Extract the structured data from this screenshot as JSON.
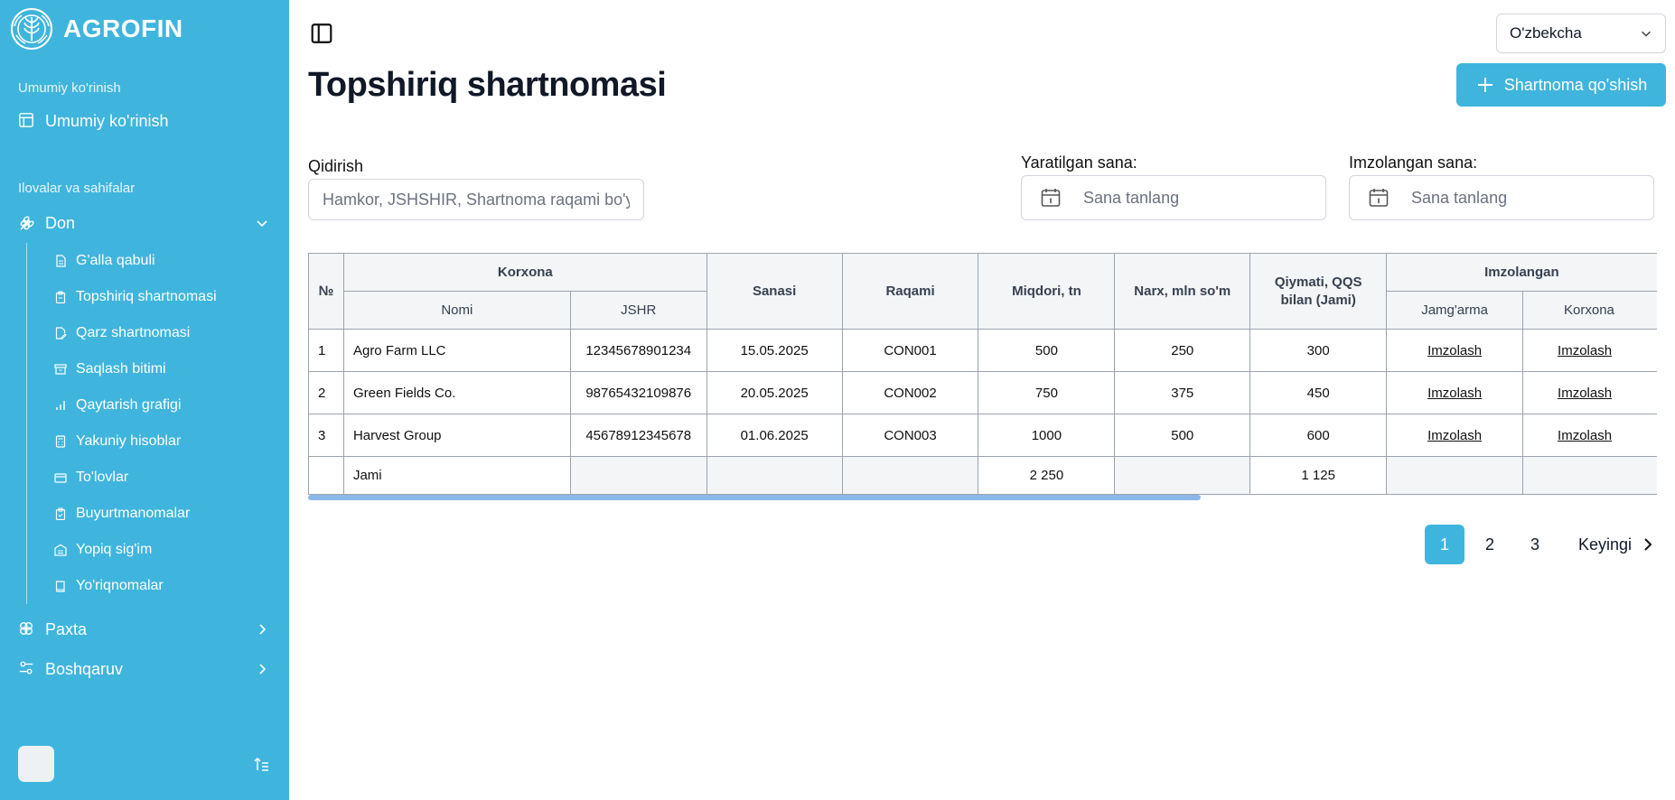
{
  "brand": {
    "name": "AGROFIN"
  },
  "sidebar": {
    "group1_label": "Umumiy ko'rinish",
    "overview": "Umumiy ko'rinish",
    "group2_label": "Ilovalar va sahifalar",
    "don": "Don",
    "sub_items": [
      "G'alla qabuli",
      "Topshiriq shartnomasi",
      "Qarz shartnomasi",
      "Saqlash bitimi",
      "Qaytarish grafigi",
      "Yakuniy hisoblar",
      "To'lovlar",
      "Buyurtmanomalar",
      "Yopiq sig'im",
      "Yo'riqnomalar"
    ],
    "paxta": "Paxta",
    "boshqaruv": "Boshqaruv"
  },
  "header": {
    "language": "O'zbekcha",
    "title": "Topshiriq shartnomasi",
    "add_button": "Shartnoma qo'shish"
  },
  "filters": {
    "search_label": "Qidirish",
    "search_placeholder": "Hamkor, JSHSHIR, Shartnoma raqami bo'yicha",
    "created_label": "Yaratilgan sana:",
    "created_placeholder": "Sana tanlang",
    "signed_label": "Imzolangan sana:",
    "signed_placeholder": "Sana tanlang"
  },
  "table": {
    "headers": {
      "num": "№",
      "korxona": "Korxona",
      "nomi": "Nomi",
      "jshr": "JSHR",
      "sanasi": "Sanasi",
      "raqami": "Raqami",
      "miqdori": "Miqdori, tn",
      "narx": "Narx, mln so'm",
      "qiymati": "Qiymati, QQS bilan (Jami)",
      "imzolangan": "Imzolangan",
      "jamgarma": "Jamg'arma",
      "korxona2": "Korxona"
    },
    "rows": [
      {
        "num": "1",
        "nomi": "Agro Farm LLC",
        "jshr": "12345678901234",
        "sanasi": "15.05.2025",
        "raqami": "CON001",
        "miqdori": "500",
        "narx": "250",
        "qiymati": "300",
        "jamgarma": "Imzolash",
        "korxona": "Imzolash"
      },
      {
        "num": "2",
        "nomi": "Green Fields Co.",
        "jshr": "98765432109876",
        "sanasi": "20.05.2025",
        "raqami": "CON002",
        "miqdori": "750",
        "narx": "375",
        "qiymati": "450",
        "jamgarma": "Imzolash",
        "korxona": "Imzolash"
      },
      {
        "num": "3",
        "nomi": "Harvest Group",
        "jshr": "45678912345678",
        "sanasi": "01.06.2025",
        "raqami": "CON003",
        "miqdori": "1000",
        "narx": "500",
        "qiymati": "600",
        "jamgarma": "Imzolash",
        "korxona": "Imzolash"
      }
    ],
    "total": {
      "label": "Jami",
      "miqdori": "2 250",
      "qiymati": "1 125"
    }
  },
  "pagination": {
    "pages": [
      "1",
      "2",
      "3"
    ],
    "active": "1",
    "next": "Keyingi"
  },
  "colors": {
    "accent": "#3fb5dd",
    "border": "#9ca3af",
    "header_bg": "#f3f5f7"
  }
}
